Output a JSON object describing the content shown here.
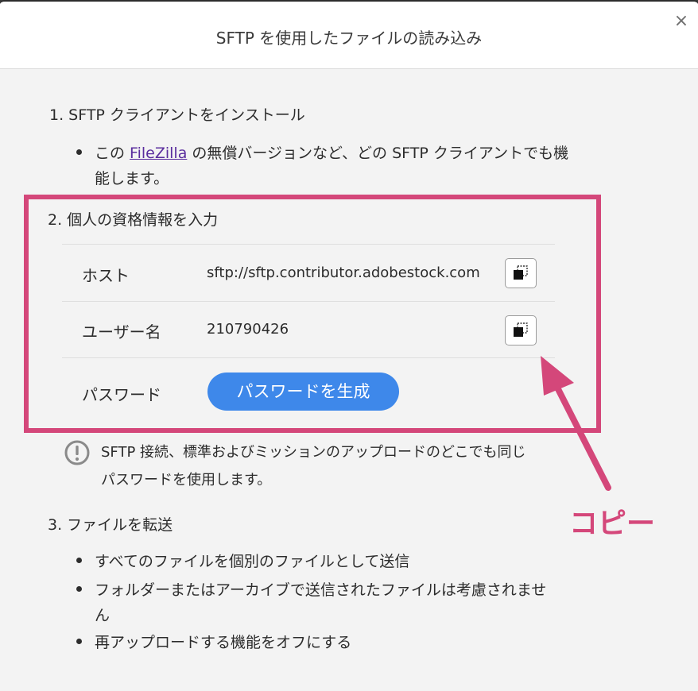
{
  "dialog": {
    "title": "SFTP を使用したファイルの読み込み",
    "close_glyph": "×"
  },
  "step1": {
    "heading": "1. SFTP クライアントをインストール",
    "bullet_pre": "この ",
    "link": "FileZilla",
    "bullet_post": " の無償バージョンなど、どの SFTP クライアントでも機",
    "bullet_cont": "能します。"
  },
  "step2": {
    "heading": "2. 個人の資格情報を入力",
    "host_label": "ホスト",
    "host_value": "sftp://sftp.contributor.adobestock.com",
    "user_label": "ユーザー名",
    "user_value": "210790426",
    "password_label": "パスワード",
    "generate_button": "パスワードを生成"
  },
  "note": {
    "line1": "SFTP 接続、標準およびミッションのアップロードのどこでも同じ",
    "line2": "パスワードを使用します。",
    "icon": "exclamation-circle-icon"
  },
  "step3": {
    "heading": "3. ファイルを転送",
    "bullets": [
      "すべてのファイルを個別のファイルとして送信",
      "フォルダーまたはアーカイブで送信されたファイルは考慮されませ",
      "ん",
      "再アップロードする機能をオフにする"
    ]
  },
  "annotation": {
    "text": "コピー",
    "color": "#d4477a"
  },
  "colors": {
    "accent": "#3e88ea",
    "highlight": "#d4477a",
    "link": "#5a2d9e"
  }
}
